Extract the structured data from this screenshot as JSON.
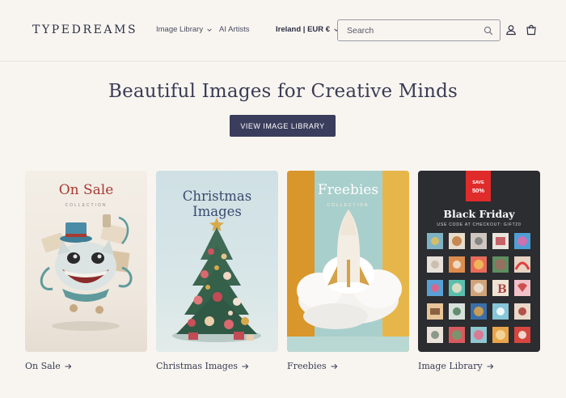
{
  "header": {
    "logo": "TYPEDREAMS",
    "nav": [
      {
        "label": "Image Library"
      },
      {
        "label": "AI Artists"
      }
    ],
    "country": "Ireland | EUR €",
    "search_placeholder": "Search"
  },
  "hero": {
    "title": "Beautiful Images for Creative Minds",
    "button": "VIEW IMAGE LIBRARY"
  },
  "cards": [
    {
      "label": "On Sale",
      "art_title": "On Sale",
      "art_sub": "COLLECTION"
    },
    {
      "label": "Christmas Images",
      "art_title_1": "Christmas",
      "art_title_2": "Images"
    },
    {
      "label": "Freebies",
      "art_title": "Freebies",
      "art_sub": "COLLECTION"
    },
    {
      "label": "Image Library",
      "badge_1": "SAVE",
      "badge_2": "50%",
      "art_title": "Black Friday",
      "code_text": "USE CODE AT CHECKOUT: GIFT20"
    }
  ],
  "colors": {
    "background": "#f8f5f0",
    "button": "#3b3d5c",
    "sale_red": "#a83a32",
    "badge_red": "#e02b2b"
  }
}
